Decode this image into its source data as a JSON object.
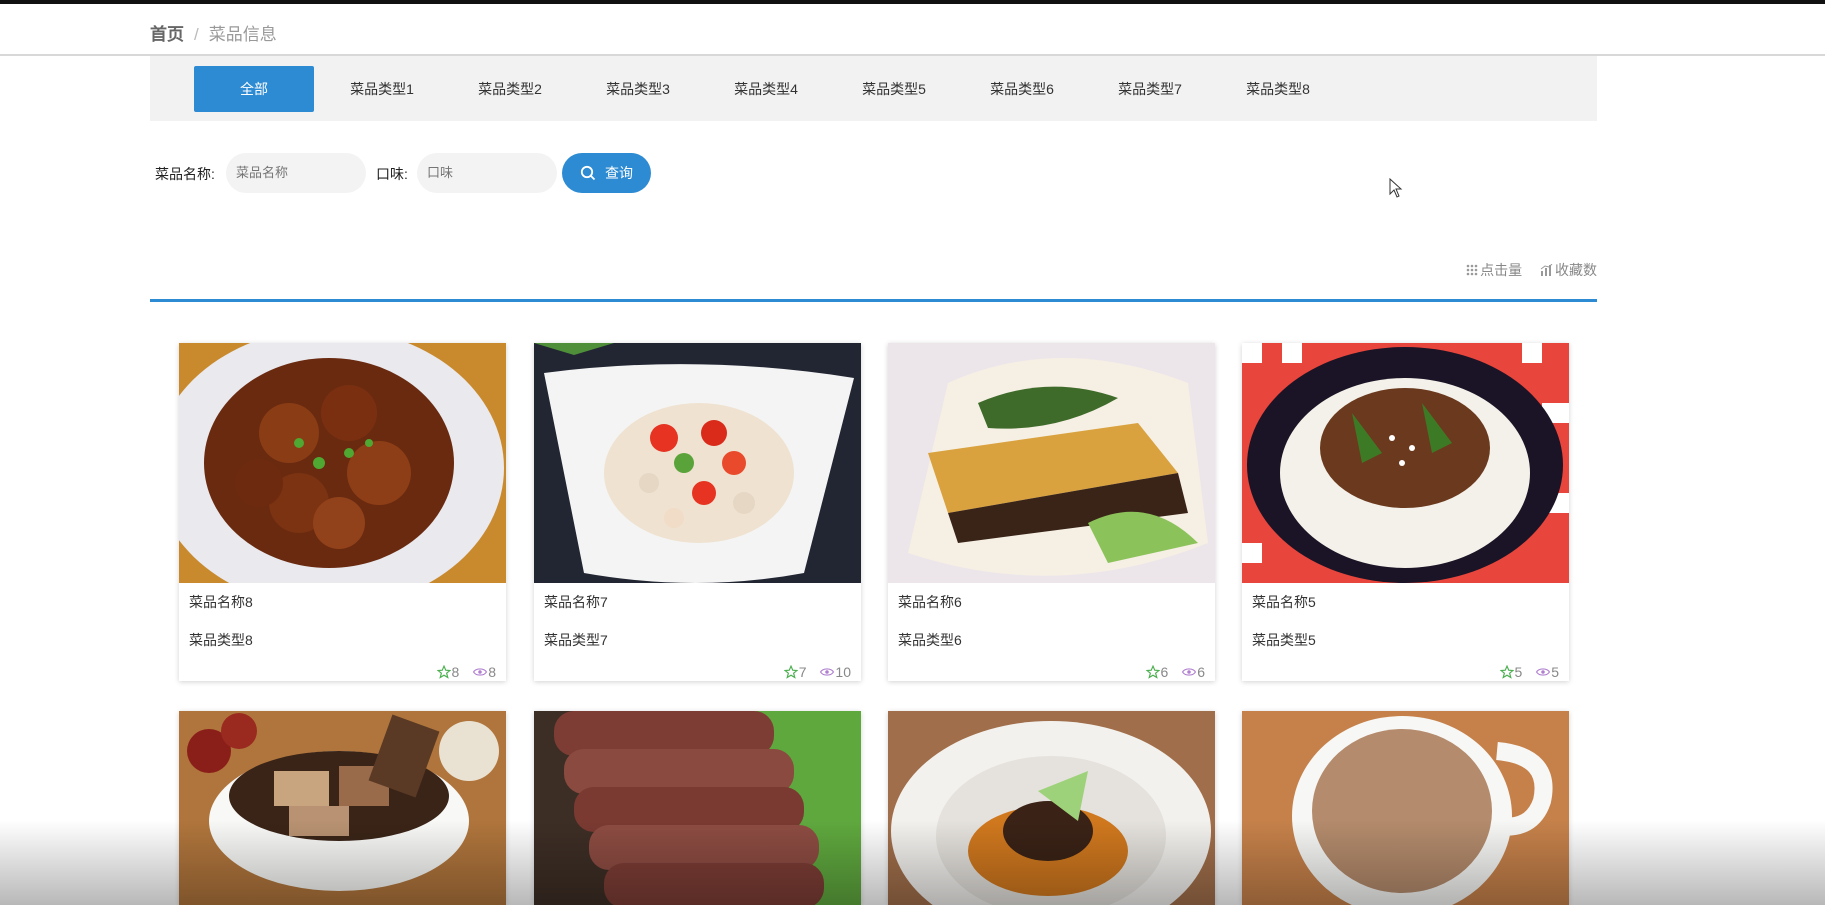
{
  "breadcrumb": {
    "home": "首页",
    "separator": "/",
    "current": "菜品信息"
  },
  "tabs": [
    {
      "label": "全部",
      "active": true
    },
    {
      "label": "菜品类型1"
    },
    {
      "label": "菜品类型2"
    },
    {
      "label": "菜品类型3"
    },
    {
      "label": "菜品类型4"
    },
    {
      "label": "菜品类型5"
    },
    {
      "label": "菜品类型6"
    },
    {
      "label": "菜品类型7"
    },
    {
      "label": "菜品类型8"
    }
  ],
  "search": {
    "name_label": "菜品名称:",
    "name_placeholder": "菜品名称",
    "taste_label": "口味:",
    "taste_placeholder": "口味",
    "button_label": "查询",
    "button_icon": "search-icon"
  },
  "sort": {
    "clicks_label": "点击量",
    "favorites_label": "收藏数"
  },
  "cards": [
    {
      "name": "菜品名称8",
      "type": "菜品类型8",
      "favorites": "8",
      "views": "8",
      "image": "braised-pork-dish"
    },
    {
      "name": "菜品名称7",
      "type": "菜品类型7",
      "favorites": "7",
      "views": "10",
      "image": "lotus-root-pepper-dish"
    },
    {
      "name": "菜品名称6",
      "type": "菜品类型6",
      "favorites": "6",
      "views": "6",
      "image": "tofu-bun-sandwich"
    },
    {
      "name": "菜品名称5",
      "type": "菜品类型5",
      "favorites": "5",
      "views": "5",
      "image": "meat-rice-bowl"
    },
    {
      "image": "pork-rib-soup"
    },
    {
      "image": "sliced-beef-lettuce"
    },
    {
      "image": "braised-meat-sauce-plate"
    },
    {
      "image": "milk-tea-cup"
    }
  ],
  "colors": {
    "accent": "#2d8bd3",
    "star": "#4caf50",
    "eye": "#b07fd0"
  }
}
